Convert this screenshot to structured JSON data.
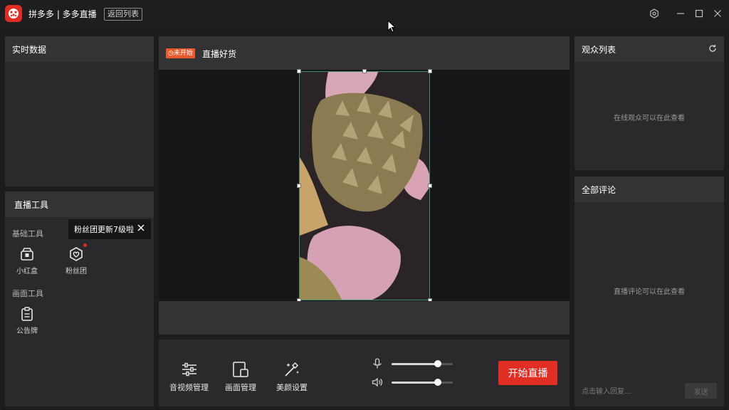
{
  "titlebar": {
    "app_name": "拼多多 | 多多直播",
    "back_label": "返回列表"
  },
  "realtime": {
    "title": "实时数据"
  },
  "tools": {
    "title": "直播工具",
    "basic_section": "基础工具",
    "basic_items": [
      {
        "label": "小红盒",
        "icon": "gift-box-icon"
      },
      {
        "label": "粉丝团",
        "icon": "fan-club-heart-icon"
      }
    ],
    "screen_section": "画面工具",
    "screen_items": [
      {
        "label": "公告牌",
        "icon": "notice-board-icon"
      }
    ],
    "tooltip": "粉丝团更新7级啦"
  },
  "stage": {
    "status_badge": "未开始",
    "title": "直播好货"
  },
  "controls": {
    "buttons": [
      {
        "label": "音视频管理",
        "icon": "sliders-icon"
      },
      {
        "label": "画面管理",
        "icon": "screen-layout-icon"
      },
      {
        "label": "美颜设置",
        "icon": "magic-wand-icon"
      }
    ],
    "mic_volume": 0.76,
    "speaker_volume": 0.76,
    "start_label": "开始直播"
  },
  "viewers": {
    "title": "观众列表",
    "empty_text": "在线观众可以在此查看"
  },
  "comments": {
    "title": "全部评论",
    "empty_text": "直播评论可以在此查看",
    "input_placeholder": "点击输入回复...",
    "send_label": "发送"
  },
  "colors": {
    "accent": "#e02e24",
    "badge": "#e8592c",
    "background": "#1c1c1f",
    "panel": "#2a2a2d"
  }
}
